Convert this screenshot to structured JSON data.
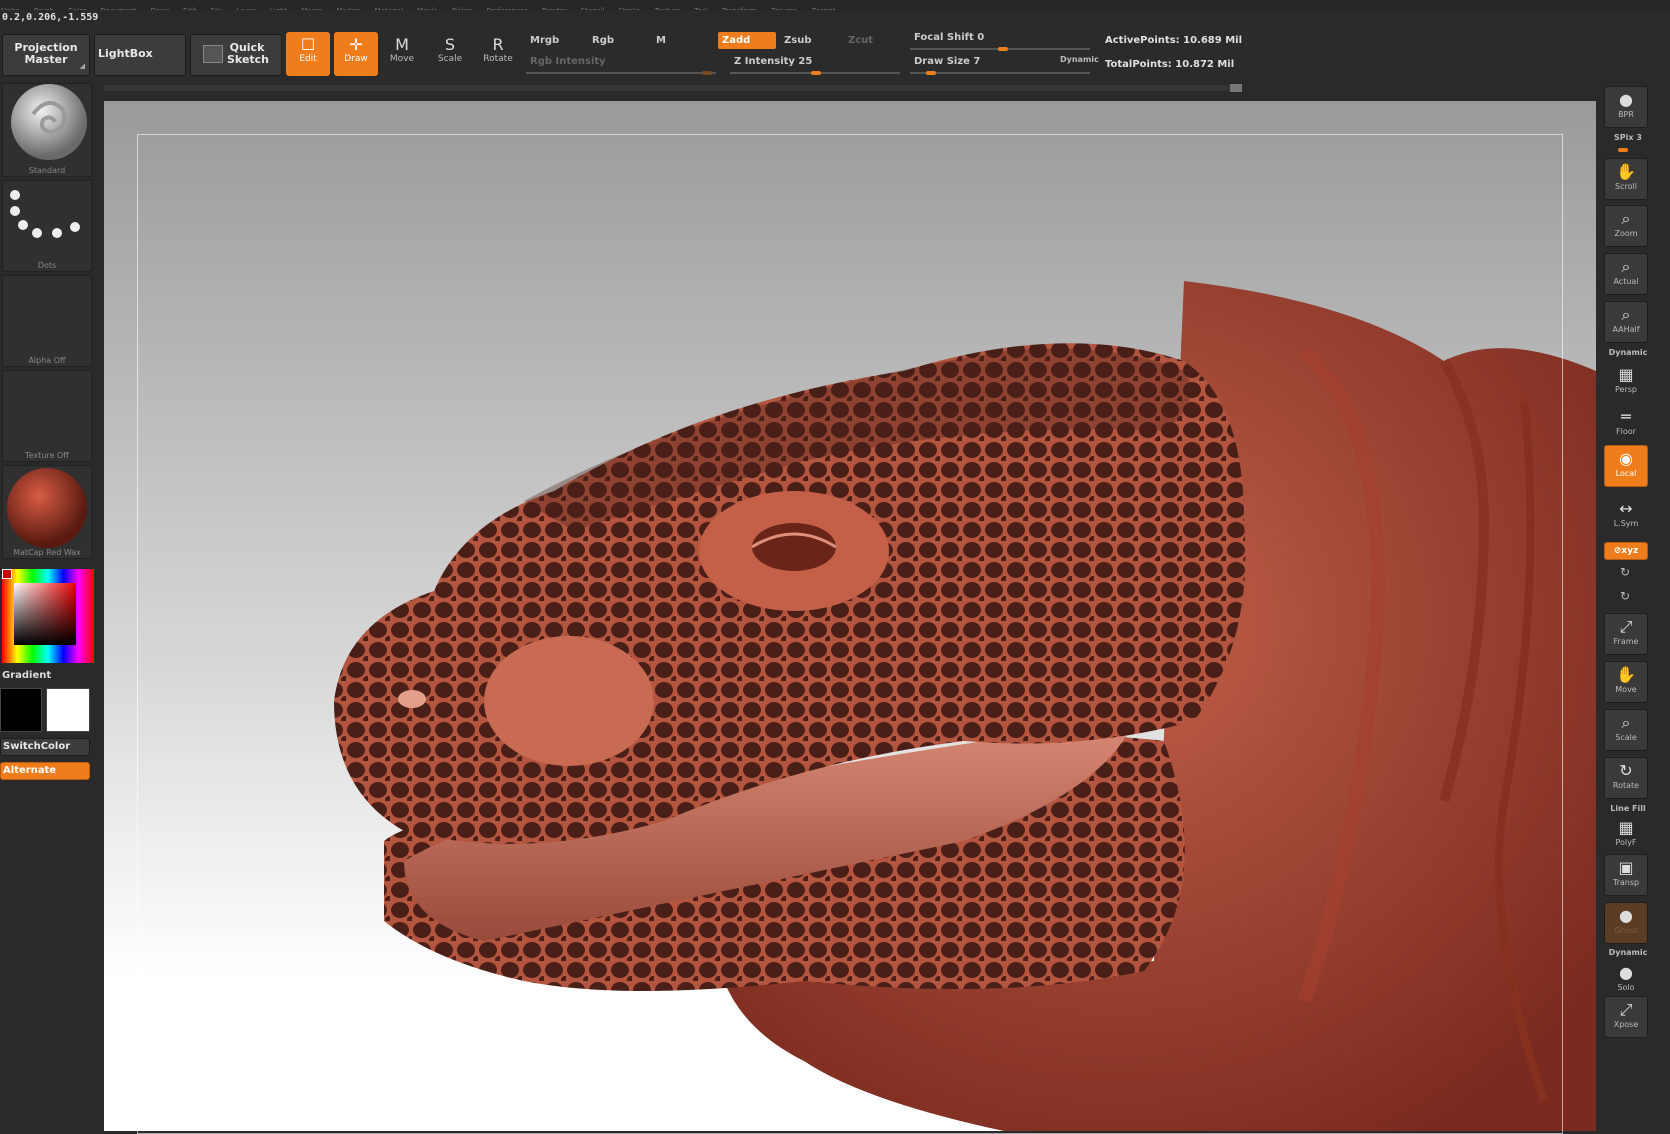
{
  "menu": [
    "Alpha",
    "Brush",
    "Color",
    "Document",
    "Draw",
    "Edit",
    "File",
    "Layer",
    "Light",
    "Macro",
    "Marker",
    "Material",
    "Movie",
    "Picker",
    "Preferences",
    "Render",
    "Stencil",
    "Stroke",
    "Texture",
    "Tool",
    "Transform",
    "Zplugin",
    "Zscript"
  ],
  "coords": "0.2,0.206,-1.559",
  "shelf": {
    "projection_master": "Projection Master",
    "lightbox": "LightBox",
    "quick_sketch": "Quick Sketch",
    "tools": [
      {
        "label": "Edit",
        "glyph": "☐"
      },
      {
        "label": "Draw",
        "glyph": "✛"
      },
      {
        "label": "Move",
        "glyph": "M"
      },
      {
        "label": "Scale",
        "glyph": "S"
      },
      {
        "label": "Rotate",
        "glyph": "R"
      }
    ],
    "mrgb": "Mrgb",
    "rgb": "Rgb",
    "m": "M",
    "zadd": "Zadd",
    "zsub": "Zsub",
    "zcut": "Zcut",
    "rgb_intensity": "Rgb Intensity",
    "z_intensity": "Z Intensity 25",
    "z_intensity_value": 0.25,
    "focal_shift": "Focal Shift 0",
    "draw_size": "Draw Size 7",
    "dynamic": "Dynamic",
    "active_points": "ActivePoints: 10.689 Mil",
    "total_points": "TotalPoints: 10.872 Mil"
  },
  "left": {
    "brush": "Standard",
    "stroke": "Dots",
    "alpha": "Alpha Off",
    "texture": "Texture Off",
    "material": "MatCap Red Wax",
    "gradient": "Gradient",
    "switch_color": "SwitchColor",
    "alternate": "Alternate"
  },
  "right": {
    "bpr": "BPR",
    "spix": "SPix 3",
    "scroll": "Scroll",
    "zoom": "Zoom",
    "actual": "Actual",
    "aahalf": "AAHalf",
    "dynamic": "Dynamic",
    "persp": "Persp",
    "floor": "Floor",
    "local": "Local",
    "lsym": "L.Sym",
    "xyz": "⊘xyz",
    "frame": "Frame",
    "move": "Move",
    "scale": "Scale",
    "rotate": "Rotate",
    "line_fill": "Line Fill",
    "polyf": "PolyF",
    "transp": "Transp",
    "ghost": "Ghost",
    "dynamic2": "Dynamic",
    "solo": "Solo",
    "xpose": "Xpose"
  },
  "colors": {
    "accent": "#f07d1c",
    "panel": "#2a2a2a",
    "skin": "#9b3a2c",
    "scales": "#4a1f18"
  }
}
